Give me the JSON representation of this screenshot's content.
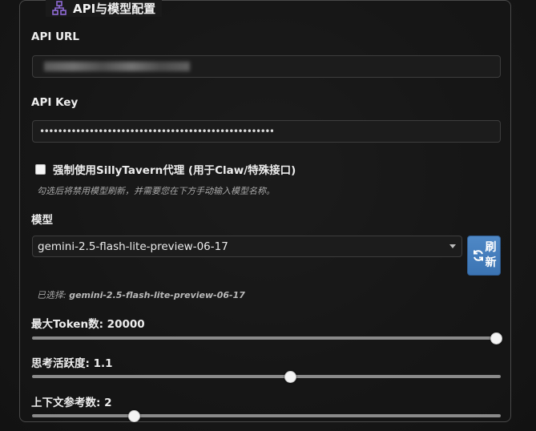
{
  "section": {
    "title": "API与模型配置",
    "icon": "network-icon",
    "accent_color": "#8f6bd6"
  },
  "api_url": {
    "label": "API URL",
    "value": "https://redacted.example/v1"
  },
  "api_key": {
    "label": "API Key",
    "masked_value": "••••••••••••••••••••••••••••••••••••••••••••••••••••"
  },
  "proxy": {
    "label": "强制使用SillyTavern代理 (用于Claw/特殊接口)",
    "checked": false,
    "hint": "勾选后将禁用模型刷新，并需要您在下方手动输入模型名称。"
  },
  "model": {
    "label": "模型",
    "selected": "gemini-2.5-flash-lite-preview-06-17",
    "refresh_label_1": "刷",
    "refresh_label_2": "新",
    "selected_note_prefix": "已选择: ",
    "selected_note_value": "gemini-2.5-flash-lite-preview-06-17",
    "button_color": "#4a82c2"
  },
  "sliders": {
    "max_tokens": {
      "label": "最大Token数: 20000",
      "value": 20000,
      "fraction": 1.0
    },
    "temperature": {
      "label": "思考活跃度: 1.1",
      "value": 1.1,
      "fraction": 0.55
    },
    "context": {
      "label": "上下文参考数: 2",
      "value": 2,
      "fraction": 0.21
    }
  }
}
